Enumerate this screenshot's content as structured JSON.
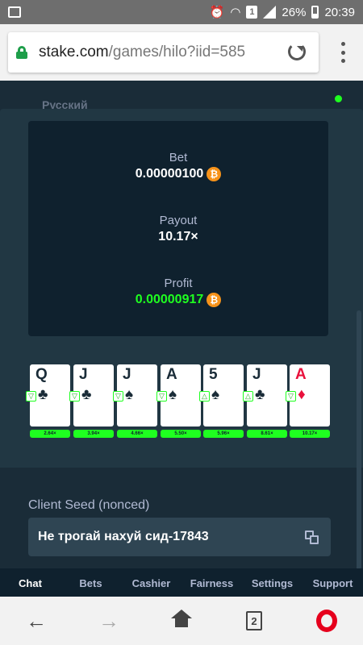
{
  "status_bar": {
    "battery": "26%",
    "time": "20:39",
    "badge": "1"
  },
  "browser": {
    "url_host": "stake.com",
    "url_path": "/games/hilo?iid=585",
    "tab_count": "2"
  },
  "site_header": {
    "language": "Русский"
  },
  "result": {
    "bet_label": "Bet",
    "bet_value": "0.00000100",
    "payout_label": "Payout",
    "payout_value": "10.17×",
    "profit_label": "Profit",
    "profit_value": "0.00000917",
    "currency_icon": "bitcoin-icon",
    "currency_symbol": "₿",
    "profit_color": "#1fff20"
  },
  "cards": [
    {
      "rank": "Q",
      "suit": "♣",
      "red": false,
      "prediction": "▽",
      "multiplier": "2.64×"
    },
    {
      "rank": "J",
      "suit": "♣",
      "red": false,
      "prediction": "▽",
      "multiplier": "3.94×"
    },
    {
      "rank": "J",
      "suit": "♠",
      "red": false,
      "prediction": "▽",
      "multiplier": "4.66×"
    },
    {
      "rank": "A",
      "suit": "♠",
      "red": false,
      "prediction": "▽",
      "multiplier": "5.50×"
    },
    {
      "rank": "5",
      "suit": "♠",
      "red": false,
      "prediction": "△",
      "multiplier": "5.96×"
    },
    {
      "rank": "J",
      "suit": "♣",
      "red": false,
      "prediction": "△",
      "multiplier": "8.61×"
    },
    {
      "rank": "A",
      "suit": "♦",
      "red": true,
      "prediction": "▽",
      "multiplier": "10.17×"
    }
  ],
  "seed": {
    "label": "Client Seed (nonced)",
    "value": "Не трогай нахуй сид-17843"
  },
  "site_nav": [
    "Chat",
    "Bets",
    "Cashier",
    "Fairness",
    "Settings",
    "Support"
  ],
  "colors": {
    "accent_green": "#1fff20",
    "bg": "#1a2c38",
    "panel": "#0f212e",
    "modal": "#213743"
  }
}
